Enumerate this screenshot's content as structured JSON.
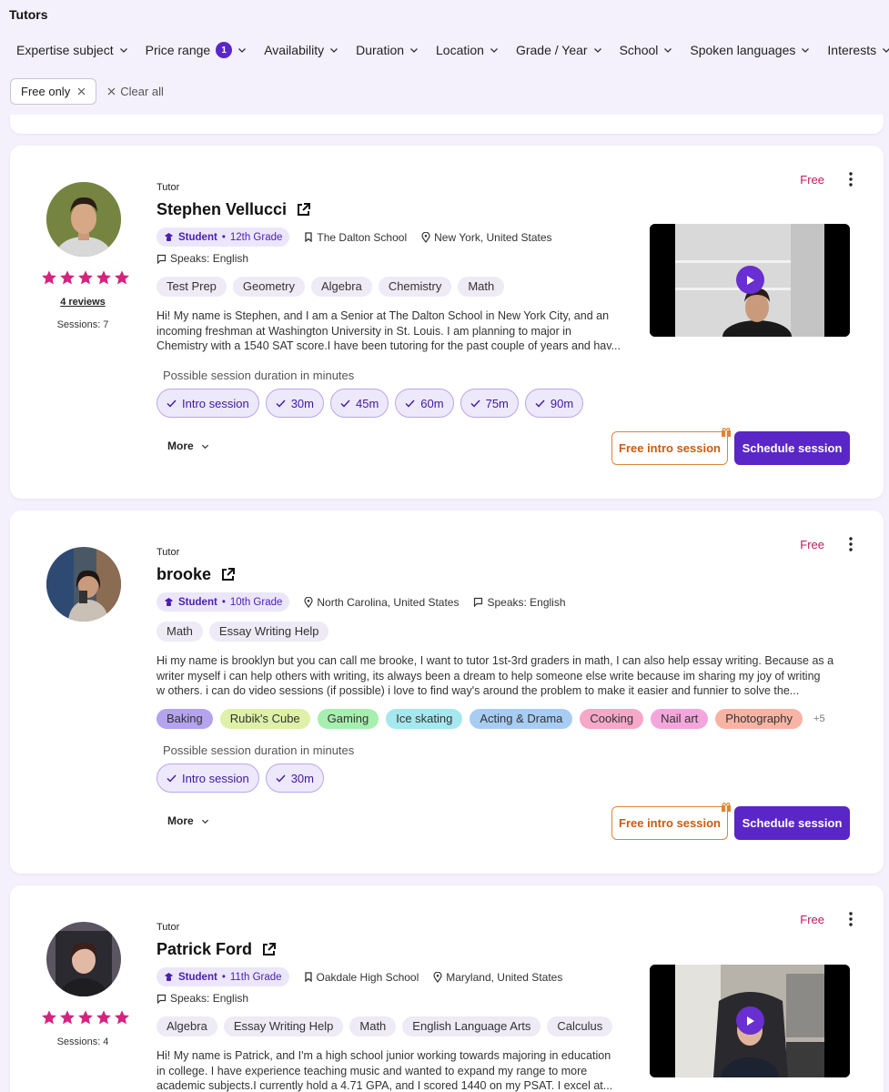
{
  "header": {
    "title": "Tutors",
    "filters": [
      {
        "label": "Expertise subject",
        "badge": ""
      },
      {
        "label": "Price range",
        "badge": "1"
      },
      {
        "label": "Availability",
        "badge": ""
      },
      {
        "label": "Duration",
        "badge": ""
      },
      {
        "label": "Location",
        "badge": ""
      },
      {
        "label": "Grade / Year",
        "badge": ""
      },
      {
        "label": "School",
        "badge": ""
      },
      {
        "label": "Spoken languages",
        "badge": ""
      },
      {
        "label": "Interests",
        "badge": ""
      }
    ],
    "active_chip": "Free only",
    "clear_all": "Clear all"
  },
  "colors": {
    "accent": "#5a26c7",
    "price": "#c2185b",
    "star": "#d6237d",
    "free_btn": "#c95d12"
  },
  "tutors": [
    {
      "role": "Tutor",
      "name": "Stephen Vellucci",
      "badge_student": "Student",
      "badge_grade": "12th Grade",
      "school": "The Dalton School",
      "location": "New York, United States",
      "speaks": "Speaks: English",
      "rating": 5,
      "reviews": "4 reviews",
      "sessions": "Sessions: 7",
      "tags": [
        "Test Prep",
        "Geometry",
        "Algebra",
        "Chemistry",
        "Math"
      ],
      "bio": [
        "Hi! My name is Stephen, and I am a Senior at The Dalton School in New York City, and an",
        "incoming freshman at Washington University in St. Louis. I am planning to major in",
        "Chemistry with a 1540 SAT score.I have been tutoring for the past couple of years and hav..."
      ],
      "duration_label": "Possible session duration in minutes",
      "durations": [
        "Intro session",
        "30m",
        "45m",
        "60m",
        "75m",
        "90m"
      ],
      "more": "More",
      "price": "Free",
      "free_intro": "Free intro session",
      "schedule": "Schedule session"
    },
    {
      "role": "Tutor",
      "name": "brooke",
      "badge_student": "Student",
      "badge_grade": "10th Grade",
      "location": "North Carolina, United States",
      "speaks": "Speaks: English",
      "tags": [
        "Math",
        "Essay Writing Help"
      ],
      "bio": [
        "Hi my name is brooklyn but you can call me brooke, I want to tutor 1st-3rd graders in math, I can also help essay writing. Because as a",
        "writer myself i can help others with writing, its always been a dream to help someone else write because im sharing my joy of writing",
        "w others. i can do video sessions (if possible) i love to find way's around the problem to make it easier and funnier to solve the..."
      ],
      "interests": [
        {
          "label": "Baking",
          "color": "#b5a3ee"
        },
        {
          "label": "Rubik's Cube",
          "color": "#dff0a8"
        },
        {
          "label": "Gaming",
          "color": "#a6efae"
        },
        {
          "label": "Ice skating",
          "color": "#a6e8ef"
        },
        {
          "label": "Acting & Drama",
          "color": "#a8cdf3"
        },
        {
          "label": "Cooking",
          "color": "#f5a8c8"
        },
        {
          "label": "Nail art",
          "color": "#f3a6dc"
        },
        {
          "label": "Photography",
          "color": "#f7b4a4"
        }
      ],
      "interests_more": "+5",
      "duration_label": "Possible session duration in minutes",
      "durations": [
        "Intro session",
        "30m"
      ],
      "more": "More",
      "price": "Free",
      "free_intro": "Free intro session",
      "schedule": "Schedule session"
    },
    {
      "role": "Tutor",
      "name": "Patrick Ford",
      "badge_student": "Student",
      "badge_grade": "11th Grade",
      "school": "Oakdale High School",
      "location": "Maryland, United States",
      "speaks": "Speaks: English",
      "rating": 5,
      "sessions": "Sessions: 4",
      "tags": [
        "Algebra",
        "Essay Writing Help",
        "Math",
        "English Language Arts",
        "Calculus"
      ],
      "bio": [
        "Hi! My name is Patrick, and I'm a high school junior working towards majoring in education",
        "in college. I have experience teaching music and wanted to expand my range to more",
        "academic subjects.I currently hold a 4.71 GPA, and I scored 1440 on my PSAT. I excel at..."
      ],
      "price": "Free"
    }
  ]
}
